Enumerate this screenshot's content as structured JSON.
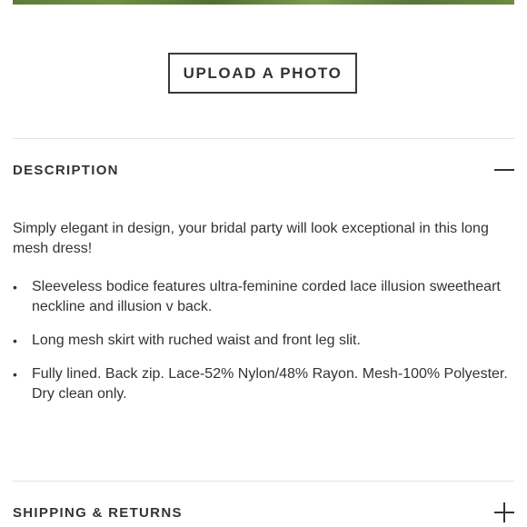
{
  "upload": {
    "label": "UPLOAD A PHOTO"
  },
  "description": {
    "title": "DESCRIPTION",
    "toggle_icon": "minus-icon",
    "intro": "Simply elegant in design, your bridal party will look exceptional in this long mesh dress!",
    "bullets": [
      "Sleeveless bodice features ultra-feminine corded lace illusion sweetheart neckline and illusion v back.",
      "Long mesh skirt with ruched waist and front leg slit.",
      "Fully lined. Back zip. Lace-52% Nylon/48% Rayon. Mesh-100% Polyester. Dry clean only."
    ],
    "bullet_glyph": "•"
  },
  "shipping": {
    "title": "SHIPPING & RETURNS",
    "toggle_icon": "plus-icon"
  }
}
